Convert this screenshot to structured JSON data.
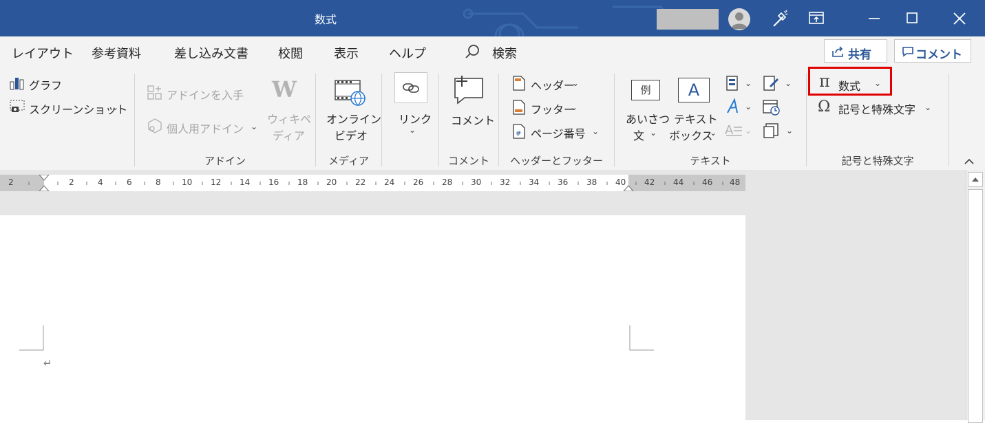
{
  "window": {
    "title": "数式"
  },
  "menu": {
    "tabs": [
      "レイアウト",
      "参考資料",
      "差し込み文書",
      "校閲",
      "表示",
      "ヘルプ"
    ],
    "search_label": "検索",
    "share_label": "共有",
    "comment_label": "コメント"
  },
  "ribbon": {
    "graph": "グラフ",
    "screenshot": "スクリーンショット",
    "get_addins": "アドインを入手",
    "my_addins": "個人用アドイン",
    "wiki_line1": "ウィキペ",
    "wiki_line2": "ディア",
    "online_video_line1": "オンライン",
    "online_video_line2": "ビデオ",
    "link": "リンク",
    "comment": "コメント",
    "header": "ヘッダー",
    "footer": "フッター",
    "page_number": "ページ番号",
    "greeting_line1": "あいさつ",
    "greeting_line2": "文",
    "textbox_line1": "テキスト",
    "textbox_line2": "ボックス",
    "equation": "数式",
    "symbol": "記号と特殊文字",
    "example_glyph": "例",
    "textbox_glyph": "A",
    "groups": {
      "addins": "アドイン",
      "media": "メディア",
      "comment": "コメント",
      "header_footer": "ヘッダーとフッター",
      "text": "テキスト",
      "symbols": "記号と特殊文字"
    }
  },
  "ruler": {
    "labels": [
      "2",
      "2",
      "4",
      "6",
      "8",
      "10",
      "12",
      "14",
      "16",
      "18",
      "20",
      "22",
      "24",
      "26",
      "28",
      "30",
      "32",
      "34",
      "36",
      "38",
      "40",
      "42",
      "44",
      "46",
      "48"
    ]
  },
  "document": {
    "paragraph_mark": "↵"
  },
  "colors": {
    "titlebar": "#2b579a",
    "ribbon_bg": "#f3f3f3",
    "highlight": "#e00000"
  }
}
